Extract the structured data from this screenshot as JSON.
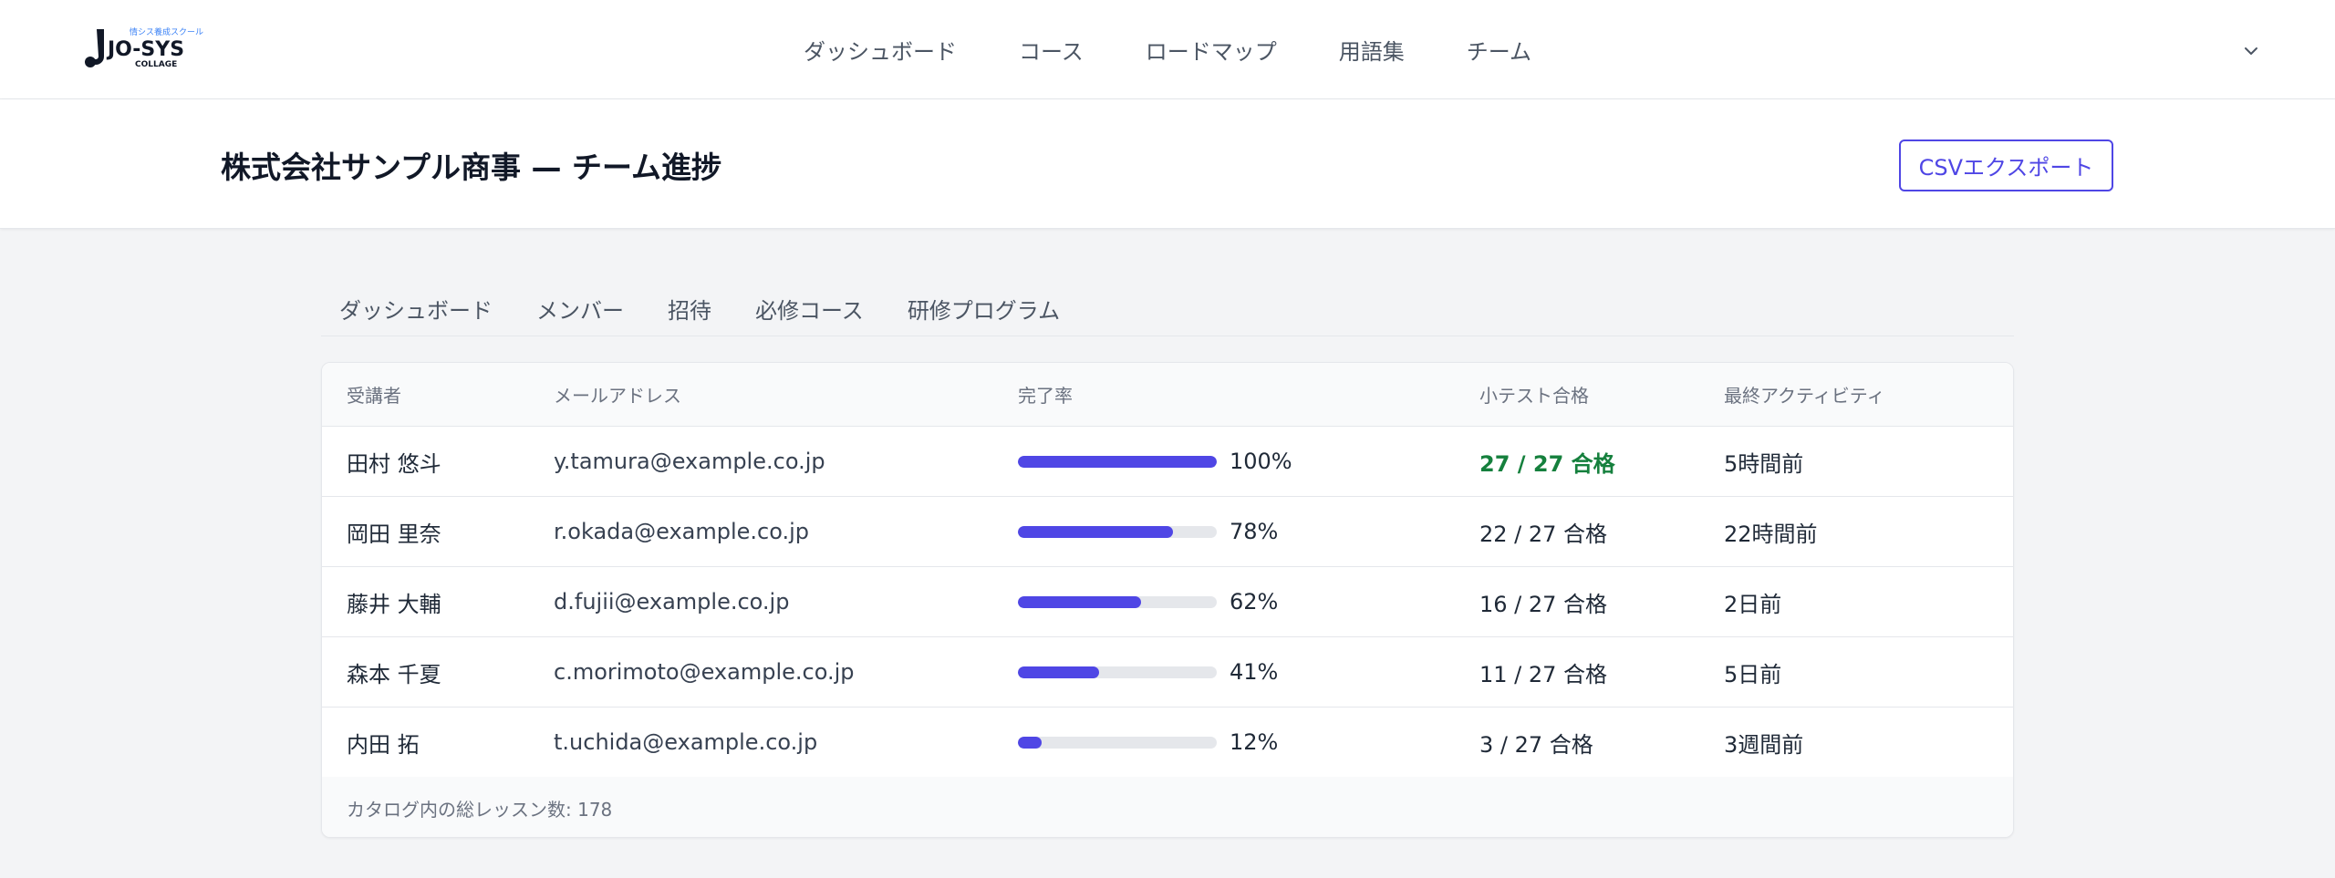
{
  "logo": {
    "tagline": "情シス養成スクール",
    "name": "JO-SYS",
    "sub": "COLLAGE"
  },
  "nav": {
    "items": [
      "ダッシュボード",
      "コース",
      "ロードマップ",
      "用語集",
      "チーム"
    ],
    "menu_icon": "chevron-down-icon"
  },
  "header": {
    "title": "株式会社サンプル商事 — チーム進捗",
    "export_label": "CSVエクスポート"
  },
  "tabs": [
    "ダッシュボード",
    "メンバー",
    "招待",
    "必修コース",
    "研修プログラム"
  ],
  "table": {
    "columns": [
      "受講者",
      "メールアドレス",
      "完了率",
      "小テスト合格",
      "最終アクティビティ"
    ],
    "rows": [
      {
        "name": "田村 悠斗",
        "email": "y.tamura@example.co.jp",
        "progress": 100,
        "progress_label": "100%",
        "quiz": "27 / 27 合格",
        "quiz_full": true,
        "last_activity": "5時間前"
      },
      {
        "name": "岡田 里奈",
        "email": "r.okada@example.co.jp",
        "progress": 78,
        "progress_label": "78%",
        "quiz": "22 / 27 合格",
        "quiz_full": false,
        "last_activity": "22時間前"
      },
      {
        "name": "藤井 大輔",
        "email": "d.fujii@example.co.jp",
        "progress": 62,
        "progress_label": "62%",
        "quiz": "16 / 27 合格",
        "quiz_full": false,
        "last_activity": "2日前"
      },
      {
        "name": "森本 千夏",
        "email": "c.morimoto@example.co.jp",
        "progress": 41,
        "progress_label": "41%",
        "quiz": "11 / 27 合格",
        "quiz_full": false,
        "last_activity": "5日前"
      },
      {
        "name": "内田 拓",
        "email": "t.uchida@example.co.jp",
        "progress": 12,
        "progress_label": "12%",
        "quiz": "3 / 27 合格",
        "quiz_full": false,
        "last_activity": "3週間前"
      }
    ],
    "footer": "カタログ内の総レッスン数: 178"
  },
  "colors": {
    "accent": "#4f46e5",
    "pass_full": "#15803d",
    "track": "#e5e7eb"
  }
}
